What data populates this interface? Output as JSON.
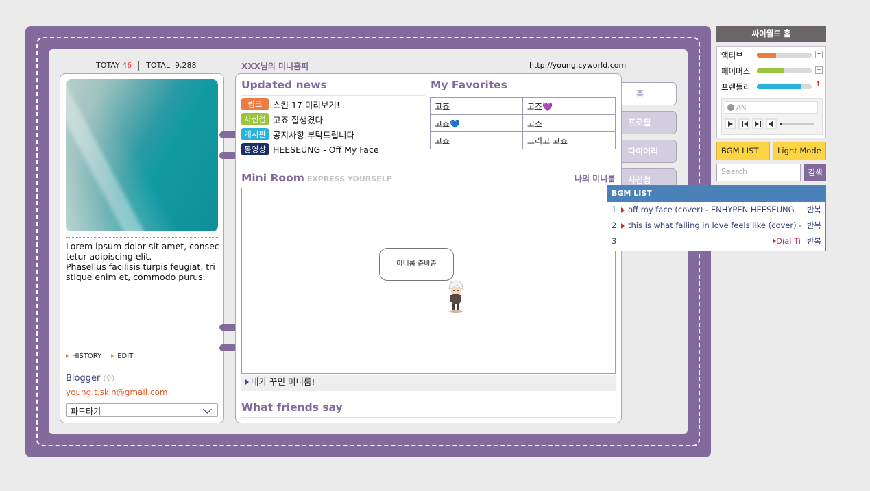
{
  "counter": {
    "today_label": "TOTAY",
    "today_value": "46",
    "total_label": "TOTAL",
    "total_value": "9,288"
  },
  "header": {
    "title": "XXX님의 미니홈피",
    "url": "http://young.cyworld.com"
  },
  "profile": {
    "intro": "Lorem ipsum dolor sit amet, consectetur adipiscing elit.\nPhasellus facilisis turpis feugiat, tristique enim et, commodo purus.",
    "history_label": "HISTORY",
    "edit_label": "EDIT",
    "name": "Blogger",
    "gender": "(♀)",
    "email": "young.t.skin@gmail.com",
    "surf_label": "파도타기"
  },
  "news": {
    "title": "Updated news",
    "items": [
      {
        "tag": "링크",
        "tag_color": "#ec7d42",
        "text": "스킨 17 미리보기!"
      },
      {
        "tag": "사진첩",
        "tag_color": "#9ac43c",
        "text": "고죠 잘생겼다"
      },
      {
        "tag": "게시판",
        "tag_color": "#29b3dc",
        "text": "공지사항 부탁드립니다"
      },
      {
        "tag": "동영상",
        "tag_color": "#1b2f66",
        "text": "HEESEUNG - Off My Face"
      }
    ]
  },
  "favorites": {
    "title": "My Favorites",
    "rows": [
      [
        "고죠",
        "고죠💜"
      ],
      [
        "고죠💙",
        "고죠"
      ],
      [
        "고죠",
        "그리고 고죠"
      ]
    ]
  },
  "miniroom": {
    "title": "Mini Room",
    "subtitle": "EXPRESS YOURSELF",
    "my_link": "나의 미니룸",
    "bubble": "미니룸 준비중",
    "footer": "내가 꾸민 미니룸!"
  },
  "friends": {
    "title": "What friends say"
  },
  "tabs": [
    {
      "label": "홈",
      "active": true
    },
    {
      "label": "프로필",
      "active": false
    },
    {
      "label": "다이어리",
      "active": false
    },
    {
      "label": "사진첩",
      "active": false
    }
  ],
  "right": {
    "title": "싸이월드 홈",
    "stats": [
      {
        "label": "액티브",
        "fraction": 0.35,
        "color": "#ec7d42",
        "btn": "−"
      },
      {
        "label": "페이머스",
        "fraction": 0.5,
        "color": "#9ac43c",
        "btn": "−"
      },
      {
        "label": "프랜들리",
        "fraction": 0.8,
        "color": "#29b3dc",
        "btn": "↑"
      }
    ],
    "player_text": "AN",
    "bgm_button": "BGM LIST",
    "mode_button": "Light Mode",
    "search_placeholder": "Search",
    "search_button": "검색"
  },
  "bgm": {
    "title": "BGM LIST",
    "items": [
      {
        "num": "1",
        "song": "off my face (cover) - ENHYPEN HEESEUNG",
        "repeat": "반복"
      },
      {
        "num": "2",
        "song": "this is what falling in love feels like (cover) - ENHYPEN",
        "repeat": "반복"
      },
      {
        "num": "3",
        "song": "",
        "repeat": "반복",
        "extra": "Dial Ti"
      }
    ]
  }
}
